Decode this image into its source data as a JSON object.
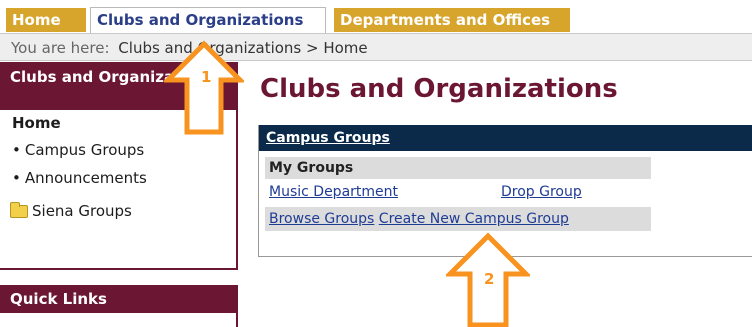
{
  "tabs": [
    {
      "label": "Home"
    },
    {
      "label": "Clubs and Organizations"
    },
    {
      "label": "Departments and Offices"
    }
  ],
  "breadcrumb": {
    "prefix": "You are here:",
    "path": "Clubs and Organizations > Home"
  },
  "sidebar": {
    "title": "Clubs and Organizations",
    "home": "Home",
    "items": [
      {
        "label": "Campus Groups"
      },
      {
        "label": "Announcements"
      }
    ],
    "folder": {
      "label": "Siena Groups",
      "icon": "folder-icon"
    },
    "quick_links": "Quick Links"
  },
  "main": {
    "title": "Clubs and Organizations",
    "panel_title": "Campus Groups",
    "my_groups": "My Groups",
    "group_name": "Music Department",
    "drop_group": "Drop Group",
    "browse": "Browse Groups",
    "create": "Create New Campus Group"
  },
  "callouts": [
    {
      "number": "1"
    },
    {
      "number": "2"
    }
  ],
  "colors": {
    "tab_gold": "#d8a52c",
    "maroon": "#6b1633",
    "navy": "#0b2a4a",
    "callout_orange": "#f7931e",
    "link_blue": "#1f3c95"
  }
}
